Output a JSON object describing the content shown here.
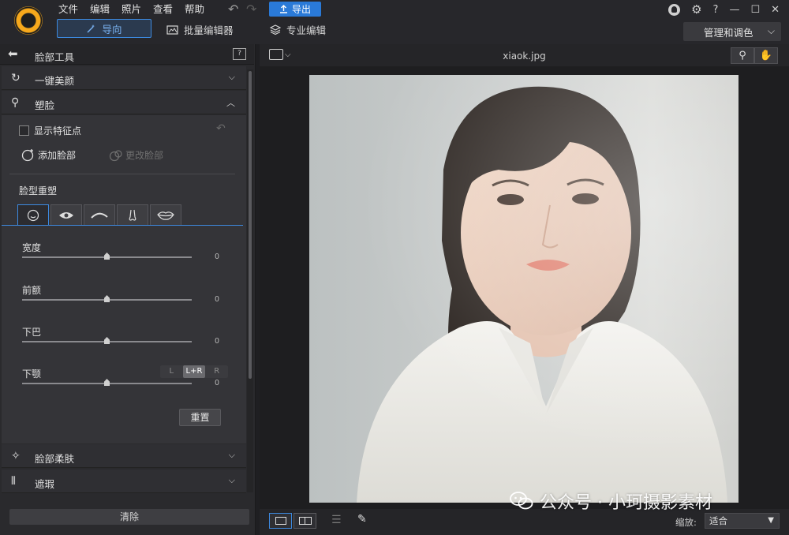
{
  "menu": [
    "文件",
    "编辑",
    "照片",
    "查看",
    "帮助"
  ],
  "export_label": "导出",
  "modes": {
    "guide": "导向",
    "batch": "批量编辑器",
    "pro": "专业编辑"
  },
  "manage_label": "管理和调色",
  "window_icons": {
    "help": "?",
    "minimize": "—",
    "maximize": "☐",
    "close": "✕"
  },
  "panel": {
    "title": "脸部工具",
    "help_icon": "?",
    "sections": {
      "beauty": "一键美颜",
      "reshape": "塑脸",
      "soften": "脸部柔肤",
      "mask": "遮瑕"
    },
    "show_points": "显示特征点",
    "add_face": "添加脸部",
    "change_face": "更改脸部",
    "shape_title": "脸型重塑",
    "face_tabs": [
      "face-icon",
      "eye-icon",
      "brow-icon",
      "nose-icon",
      "lips-icon"
    ],
    "sliders": [
      {
        "label": "宽度",
        "value": "0"
      },
      {
        "label": "前额",
        "value": "0"
      },
      {
        "label": "下巴",
        "value": "0"
      },
      {
        "label": "下颚",
        "value": "0"
      }
    ],
    "lr_options": [
      "L",
      "L+R",
      "R"
    ],
    "lr_selected": "L+R",
    "reset_label": "重置",
    "clear_label": "清除"
  },
  "viewer": {
    "filename": "xiaok.jpg",
    "zoom_label": "缩放:",
    "zoom_value": "适合"
  },
  "watermark": "公众号 · 小珂摄影素材",
  "colors": {
    "accent": "#3d8ae0",
    "export": "#2a7ad8",
    "logo": "#f6a81c"
  }
}
